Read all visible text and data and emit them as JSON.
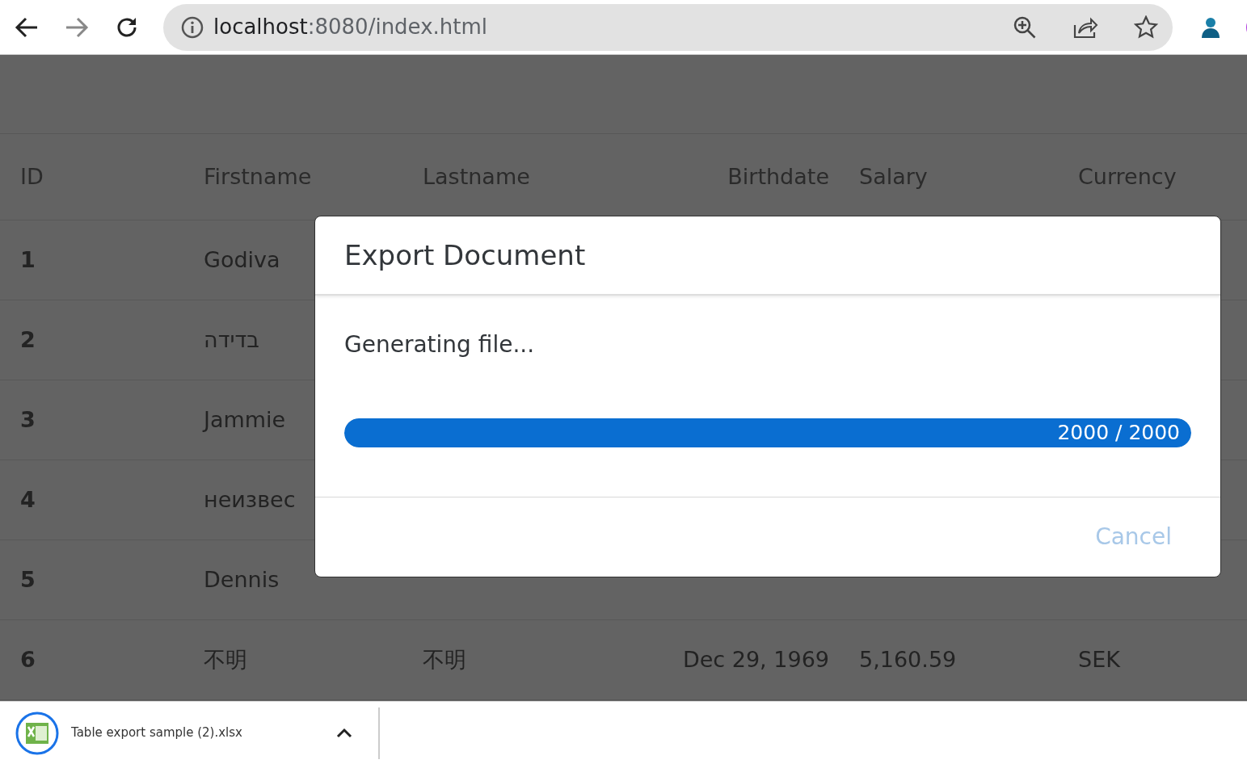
{
  "browser": {
    "url_host": "localhost",
    "url_path": ":8080/index.html",
    "forward_disabled": true
  },
  "table": {
    "columns": [
      "ID",
      "Firstname",
      "Lastname",
      "Birthdate",
      "Salary",
      "Currency"
    ],
    "rows": [
      {
        "cells": [
          "1",
          "Godiva"
        ]
      },
      {
        "cells": [
          "2",
          "בדידה"
        ]
      },
      {
        "cells": [
          "3",
          "Jammie"
        ]
      },
      {
        "cells": [
          "4",
          "неизвес"
        ]
      },
      {
        "cells": [
          "5",
          "Dennis"
        ]
      },
      {
        "cells": [
          "6",
          "不明",
          "不明",
          "Dec 29, 1969",
          "5,160.59",
          "SEK"
        ]
      }
    ]
  },
  "dialog": {
    "title": "Export Document",
    "message": "Generating file...",
    "progress": {
      "level": 1,
      "reading": "2000 / 2000"
    },
    "cancel": {
      "label": "Cancel",
      "disabled": true
    }
  },
  "download": {
    "filename": "Table export sample (2).xlsx"
  }
}
